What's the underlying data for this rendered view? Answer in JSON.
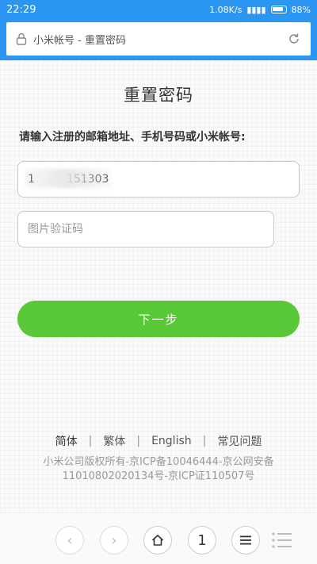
{
  "status_bar": {
    "time": "22:29",
    "network": "1.08K/s",
    "battery": "88%"
  },
  "address_bar": {
    "title": "小米帐号 - 重置密码"
  },
  "form": {
    "title": "重置密码",
    "instruction": "请输入注册的邮箱地址、手机号码或小米帐号:",
    "account_value": "1         151303",
    "captcha_placeholder": "图片验证码",
    "next_label": "下一步"
  },
  "footer": {
    "links": [
      "简体",
      "繁体",
      "English",
      "常见问题"
    ],
    "separator": "|",
    "copyright_line1": "小米公司版权所有-京ICP备10046444-京公网安备",
    "copyright_line2": "11010802020134号-京ICP证110507号"
  },
  "bottom_nav": {
    "back_icon": "‹",
    "forward_icon": "›",
    "tabs_count": "1"
  },
  "colors": {
    "brand_blue": "#2b95f2",
    "button_green": "#59c836"
  }
}
